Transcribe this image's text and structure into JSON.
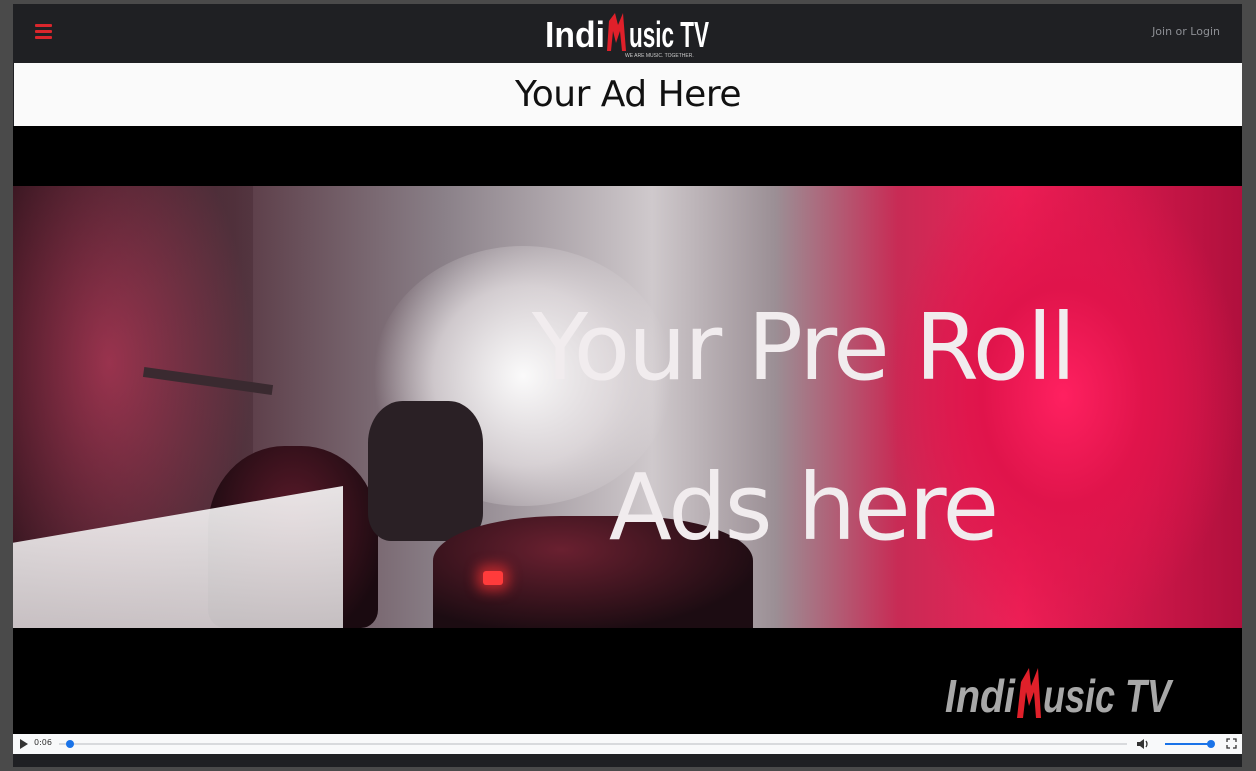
{
  "header": {
    "brand": {
      "logo_text": "IndiMusic TV",
      "tagline": "WE ARE MUSIC. TOGETHER."
    },
    "login_label": "Join or Login",
    "menu_icon": "hamburger-menu-icon"
  },
  "ad_banner": {
    "text": "Your Ad Here"
  },
  "video": {
    "overlay_lines": [
      "Your Pre Roll",
      "Ads here"
    ],
    "watermark_text": "IndiMusic TV",
    "controls": {
      "time": "0:06",
      "progress": 0.01,
      "volume": 1.0,
      "play_icon": "play-icon",
      "volume_icon": "volume-icon",
      "fullscreen_icon": "fullscreen-icon"
    }
  },
  "colors": {
    "accent": "#d9262c",
    "nav_bg": "#1f2023",
    "progress": "#1a73e8"
  }
}
